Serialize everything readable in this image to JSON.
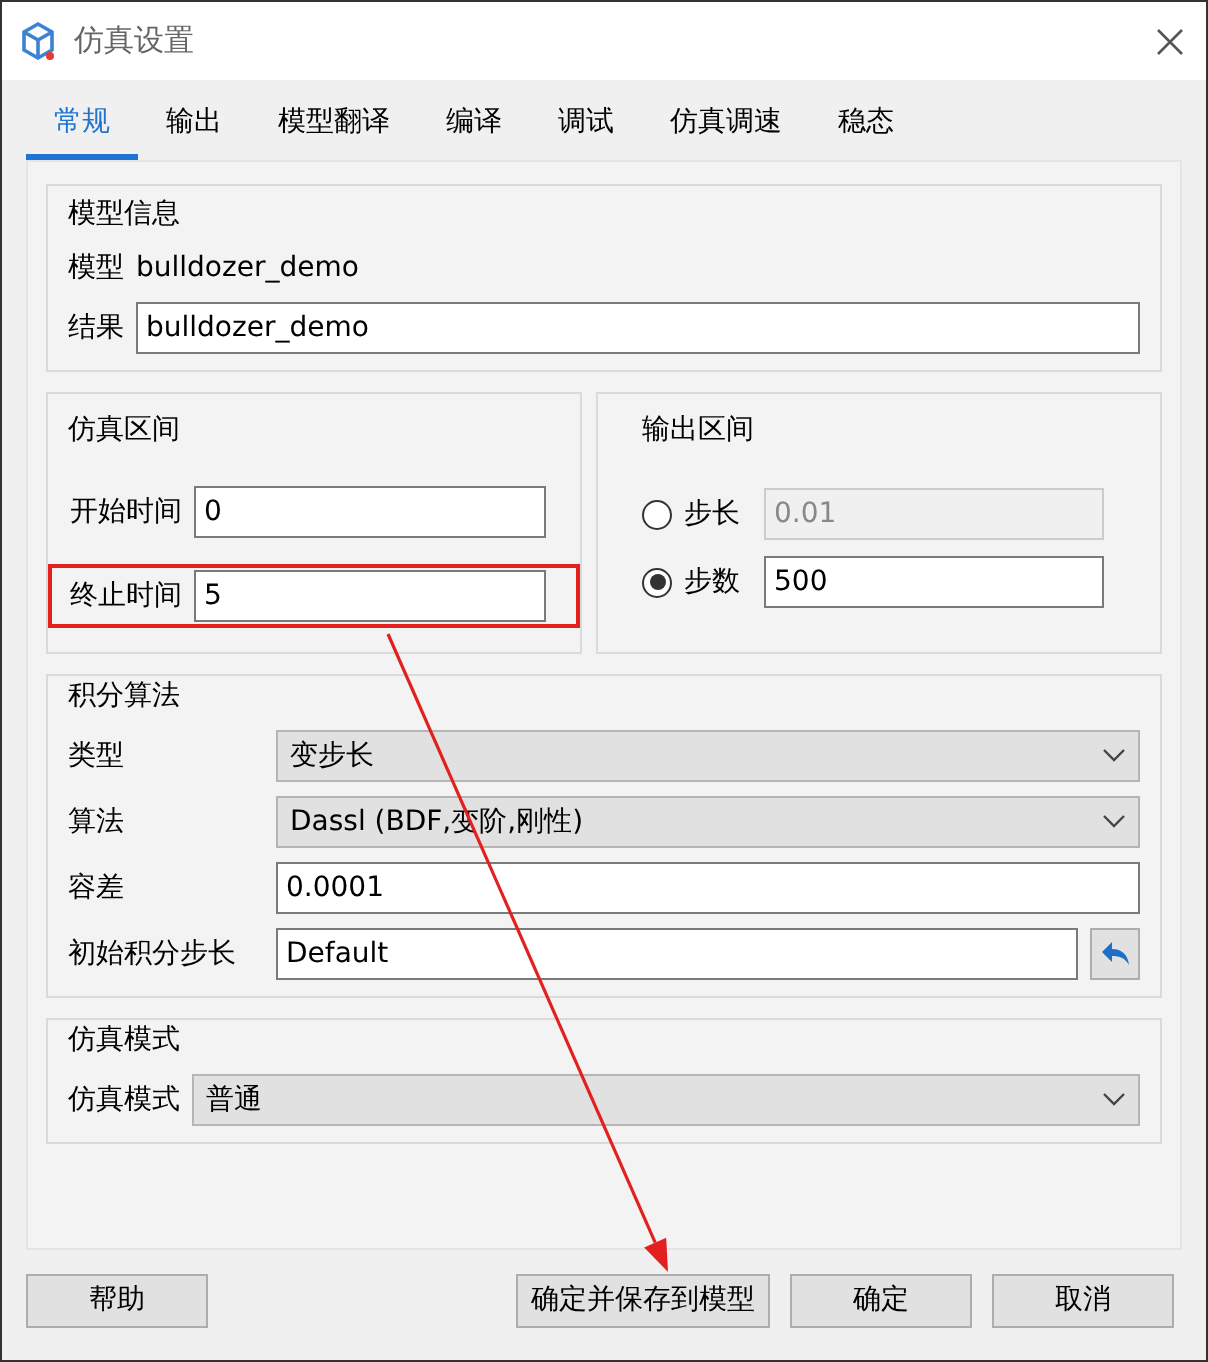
{
  "window": {
    "title": "仿真设置"
  },
  "tabs": [
    {
      "label": "常规",
      "selected": true
    },
    {
      "label": "输出",
      "selected": false
    },
    {
      "label": "模型翻译",
      "selected": false
    },
    {
      "label": "编译",
      "selected": false
    },
    {
      "label": "调试",
      "selected": false
    },
    {
      "label": "仿真调速",
      "selected": false
    },
    {
      "label": "稳态",
      "selected": false
    }
  ],
  "model_info": {
    "title": "模型信息",
    "model_label": "模型",
    "model_value": "bulldozer_demo",
    "result_label": "结果",
    "result_value": "bulldozer_demo"
  },
  "sim_interval": {
    "title": "仿真区间",
    "fields": [
      {
        "label": "开始时间",
        "value": "0",
        "highlighted": false
      },
      {
        "label": "终止时间",
        "value": "5",
        "highlighted": true
      }
    ]
  },
  "output_interval": {
    "title": "输出区间",
    "options": [
      {
        "label": "步长",
        "value": "0.01",
        "selected": false,
        "disabled": true
      },
      {
        "label": "步数",
        "value": "500",
        "selected": true,
        "disabled": false
      }
    ]
  },
  "integration": {
    "title": "积分算法",
    "rows": [
      {
        "kind": "select",
        "label": "类型",
        "value": "变步长"
      },
      {
        "kind": "select",
        "label": "算法",
        "value": "Dassl (BDF,变阶,刚性)"
      },
      {
        "kind": "input",
        "label": "容差",
        "value": "0.0001"
      },
      {
        "kind": "input-reset",
        "label": "初始积分步长",
        "value": "Default"
      }
    ]
  },
  "sim_mode": {
    "title": "仿真模式",
    "label": "仿真模式",
    "value": "普通"
  },
  "buttons": [
    "帮助",
    "确定并保存到模型",
    "确定",
    "取消"
  ],
  "annotation": {
    "arrow": true
  }
}
